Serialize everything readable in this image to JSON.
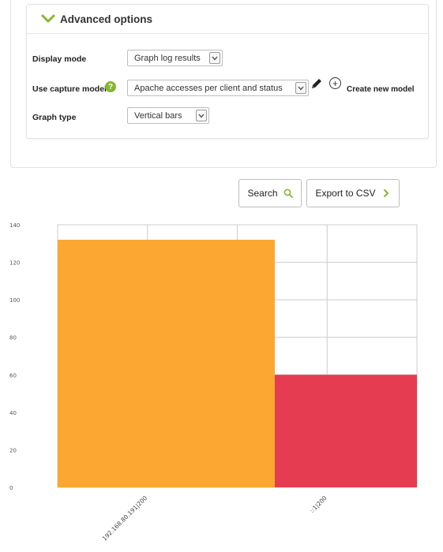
{
  "advanced": {
    "title": "Advanced options",
    "display_mode": {
      "label": "Display mode",
      "value": "Graph log results"
    },
    "capture_model": {
      "label": "Use capture model",
      "value": "Apache accesses per client and status",
      "create_label": "Create new model"
    },
    "graph_type": {
      "label": "Graph type",
      "value": "Vertical bars"
    }
  },
  "buttons": {
    "search": "Search",
    "export": "Export to CSV"
  },
  "icons": {
    "chevron": "chevron-down-icon",
    "help": "help-icon",
    "pencil": "pencil-icon",
    "add": "add-circle-icon",
    "search": "search-icon",
    "export": "chevron-right-icon"
  },
  "colors": {
    "accent": "#82b92e",
    "bar1": "#fba731",
    "bar2": "#e63c52"
  },
  "chart_data": {
    "type": "bar",
    "categories": [
      "192.168.80.191|200",
      "::1|200"
    ],
    "values": [
      132,
      60
    ],
    "ylim": [
      0,
      140
    ],
    "yticks": [
      0,
      20,
      40,
      60,
      80,
      100,
      120,
      140
    ],
    "colors": [
      "#fba731",
      "#e63c52"
    ],
    "grid": true,
    "title": "",
    "xlabel": "",
    "ylabel": ""
  }
}
